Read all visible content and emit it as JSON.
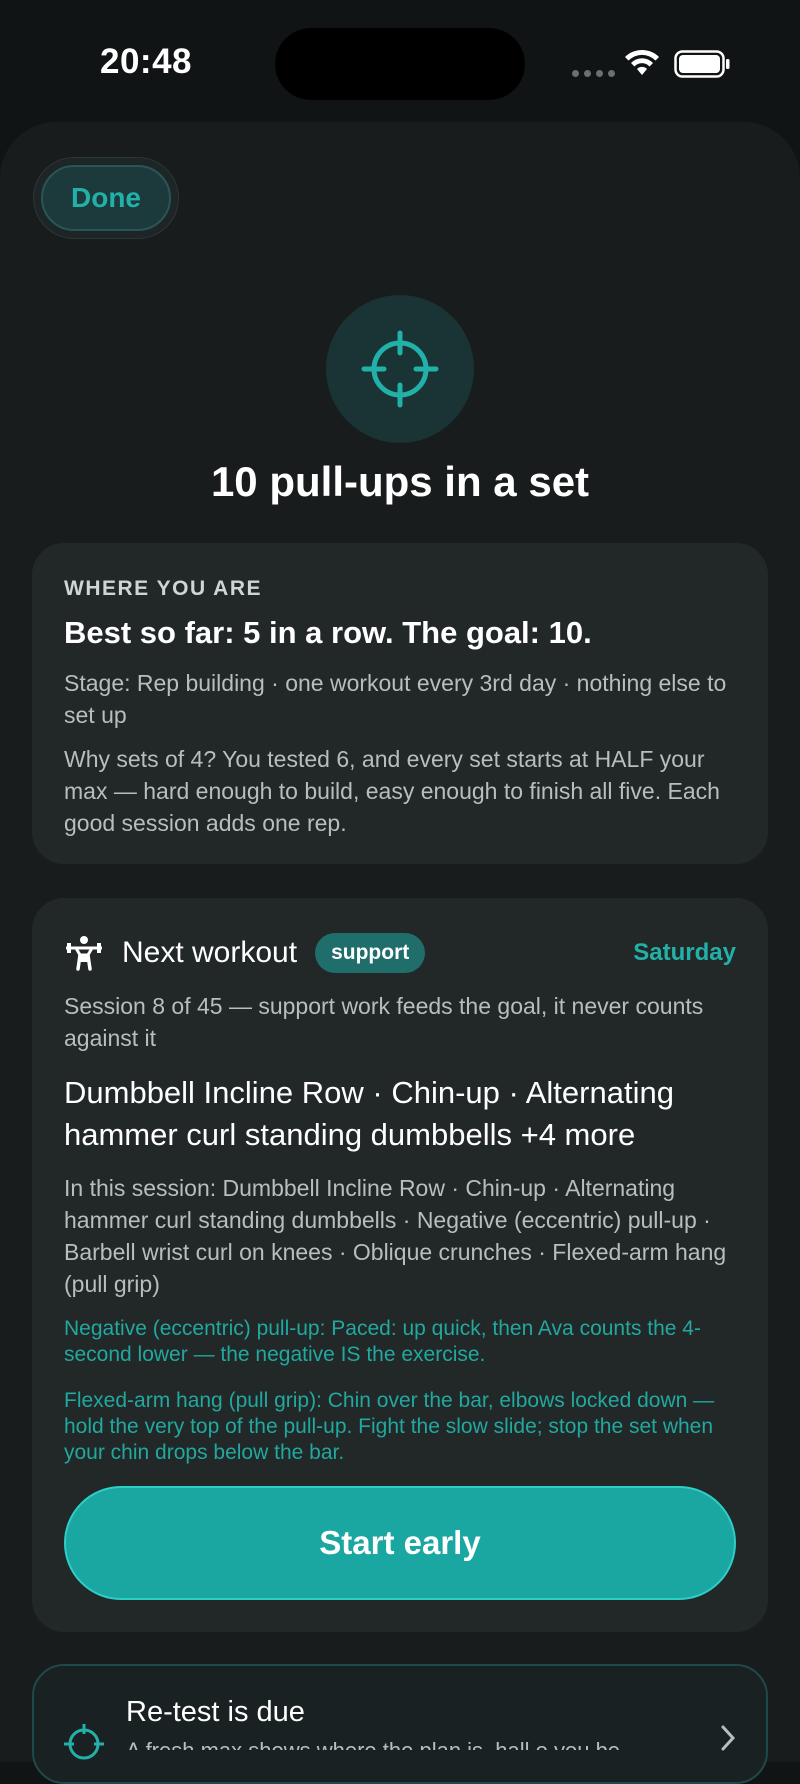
{
  "status_bar": {
    "time": "20:48"
  },
  "header": {
    "done_label": "Done"
  },
  "goal": {
    "icon": "crosshair-icon",
    "title": "10 pull-ups in a set"
  },
  "where_card": {
    "eyebrow": "WHERE YOU ARE",
    "headline": "Best so far: 5 in a row. The goal: 10.",
    "stage": "Stage: Rep building · one workout every 3rd day · nothing else to set up",
    "explanation": "Why sets of 4? You tested 6, and every set starts at HALF your max — hard enough to build, easy enough to finish all five. Each good session adds one rep."
  },
  "next_card": {
    "icon": "weightlifter-icon",
    "title": "Next workout",
    "badge": "support",
    "day": "Saturday",
    "session": "Session 8 of 45 — support work feeds the goal, it never counts against it",
    "exercises_headline": "Dumbbell Incline Row · Chin-up · Alternating hammer curl standing dumbbells +4 more",
    "session_list": "In this session: Dumbbell Incline Row · Chin-up · Alternating hammer curl standing dumbbells · Negative (eccentric) pull-up · Barbell wrist curl on knees · Oblique crunches · Flexed-arm hang (pull grip)",
    "tips": [
      "Negative (eccentric) pull-up: Paced: up quick, then Ava counts the 4-second lower — the negative IS the exercise.",
      "Flexed-arm hang (pull grip): Chin over the bar, elbows locked down — hold the very top of the pull-up. Fight the slow slide; stop the set when your chin drops below the bar."
    ],
    "start_label": "Start early"
  },
  "retest_card": {
    "title": "Re-test is due",
    "subtitle": "A fresh max shows where the plan is, hall o you be",
    "icon": "crosshair-icon"
  },
  "colors": {
    "accent": "#22b1a8",
    "button": "#1aa6a1",
    "background": "#111415",
    "card": "#222728"
  }
}
